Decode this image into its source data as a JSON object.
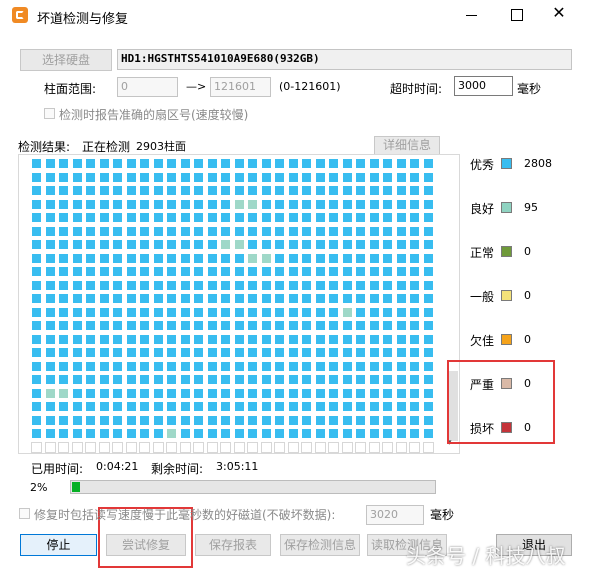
{
  "window": {
    "title": "坏道检测与修复",
    "controls": [
      "minimize",
      "maximize",
      "close"
    ]
  },
  "disk": {
    "select_button": "选择硬盘",
    "name": "HD1:HGSTHTS541010A9E680(932GB)"
  },
  "range": {
    "label": "柱面范围:",
    "start": "0",
    "arrow": "—>",
    "end": "121601",
    "hint": "(0-121601)"
  },
  "timeout": {
    "label": "超时时间:",
    "value": "3000",
    "unit": "毫秒"
  },
  "report_sector_label": "检测时报告准确的扇区号(速度较慢)",
  "result": {
    "label": "检测结果:",
    "status": "正在检测",
    "count_text": "2903柱面",
    "detail_button": "详细信息"
  },
  "legend": [
    {
      "name": "优秀",
      "count": "2808",
      "color": "#38bdf0"
    },
    {
      "name": "良好",
      "count": "95",
      "color": "#8fd3c1"
    },
    {
      "name": "正常",
      "count": "0",
      "color": "#6f9a3a"
    },
    {
      "name": "一般",
      "count": "0",
      "color": "#f4e27a"
    },
    {
      "name": "欠佳",
      "count": "0",
      "color": "#f5a31a"
    },
    {
      "name": "严重",
      "count": "0",
      "color": "#d9b9a7"
    },
    {
      "name": "损坏",
      "count": "0",
      "color": "#c4343a"
    }
  ],
  "time": {
    "used_label": "已用时间:",
    "used": "0:04:21",
    "remaining_label": "剩余时间:",
    "remaining": "3:05:11"
  },
  "progress": {
    "percent_label": "2%",
    "value": 0.02
  },
  "repair_option": {
    "label": "修复时包括读写速度慢于此毫秒数的好磁道(不破坏数据):",
    "value": "3020",
    "unit": "毫秒"
  },
  "buttons": {
    "stop": "停止",
    "try_repair": "尝试修复",
    "save_report": "保存报表",
    "save_info": "保存检测信息",
    "read_info": "读取检测信息",
    "exit": "退出"
  },
  "watermark": "头条号 / 科技八叔",
  "grid": {
    "rows": 22,
    "cols": 30,
    "filled_cells": 630,
    "good_cells": [
      [
        3,
        15
      ],
      [
        3,
        16
      ],
      [
        6,
        14
      ],
      [
        6,
        15
      ],
      [
        7,
        16
      ],
      [
        7,
        17
      ],
      [
        11,
        23
      ],
      [
        17,
        1
      ],
      [
        17,
        2
      ],
      [
        20,
        10
      ]
    ]
  },
  "colors": {
    "excellent": "#38bdf0",
    "good": "#9fd8c8",
    "empty": "#ffffff",
    "highlight": "#e23838",
    "accent": "#0078d7"
  }
}
